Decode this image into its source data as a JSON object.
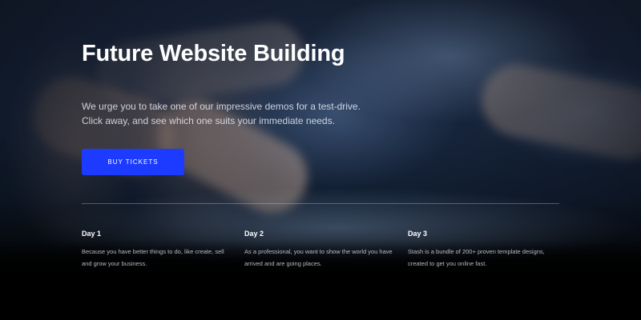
{
  "hero": {
    "title": "Future Website Building",
    "subtitle_line1": "We urge you to take one of our impressive demos for a test-drive.",
    "subtitle_line2": "Click away, and see which one suits your immediate needs.",
    "cta_label": "BUY TICKETS",
    "accent_color": "#1c3bff"
  },
  "days": [
    {
      "title": "Day 1",
      "line1": "Because you have better things to do, like create, sell",
      "line2": "and grow your business."
    },
    {
      "title": "Day 2",
      "line1": "As a professional, you want to show the world you have",
      "line2": "arrived and are going places."
    },
    {
      "title": "Day 3",
      "line1": "Stash is a bundle of 200+ proven template designs,",
      "line2": "created to get you online fast."
    }
  ]
}
